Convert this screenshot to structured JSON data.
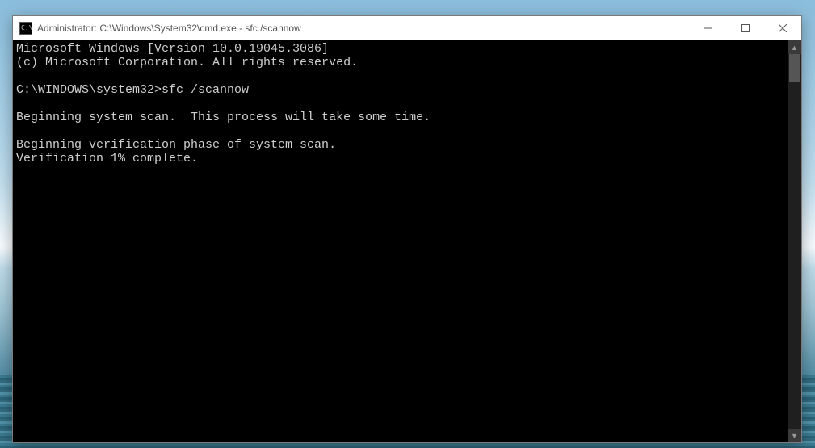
{
  "titlebar": {
    "title": "Administrator: C:\\Windows\\System32\\cmd.exe - sfc  /scannow"
  },
  "console": {
    "line1": "Microsoft Windows [Version 10.0.19045.3086]",
    "line2": "(c) Microsoft Corporation. All rights reserved.",
    "blank1": "",
    "promptPath": "C:\\WINDOWS\\system32>",
    "command": "sfc /scannow",
    "blank2": "",
    "scanStart": "Beginning system scan.  This process will take some time.",
    "blank3": "",
    "verifyStart": "Beginning verification phase of system scan.",
    "verifyProgress": "Verification 1% complete."
  },
  "scrollbar": {
    "upGlyph": "▲",
    "downGlyph": "▼"
  }
}
